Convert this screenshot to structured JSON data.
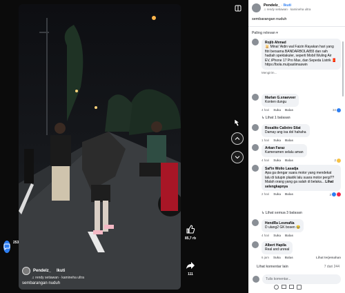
{
  "post": {
    "author": "Pendelz_",
    "follow": "Ikuti",
    "music": "rendy setiawan · kamineha ultra",
    "caption": "sembarangan nuduh"
  },
  "video": {
    "author": "Pendelz_",
    "follow": "Ikuti",
    "music": "rendy setiawan · kamineha ultra",
    "caption": "sembarangan nuduh"
  },
  "rail": {
    "likes": "85,7 rb",
    "comments": "253",
    "shares": "111"
  },
  "panel": {
    "sort_label": "Paling relevan",
    "comments": [
      {
        "name": "Rojib Ahmad",
        "text": "🕌 Minal 'Aidin wal Faizin Rayakan hari yang fitri bersama BANDARBOLA855 dan raih hadiah spektakuler, seperti Mobil Wuling Air EV, iPhone 17 Pro Max, dan Sepeda Listrik 🧧 https://bola.mu/pastimaswin",
        "footer": "Mengirim..."
      },
      {
        "name": "Marlan G.snaeveer",
        "text": "Konten dungu",
        "time": "4 hari",
        "like": "Suka",
        "reply": "Balas",
        "count": "34"
      },
      {
        "more_replies": "Lihat 1 balasan"
      },
      {
        "name": "Rosalito Calixtro Silat",
        "text": "Damay ang isa dol hahaha",
        "time": "1 hari",
        "like": "Suka",
        "reply": "Balas"
      },
      {
        "name": "Arkan Faraz",
        "text": "Kameramen selalu aman",
        "time": "4 hari",
        "like": "Suka",
        "reply": "Balas",
        "count": "2"
      },
      {
        "name": "Saf'in Wolio Lasadja",
        "text": "Apa ga dengar suara motor yang mendekat lalu di tutupin plastik lalu suara motor pergi?? Malah orang yang ga salah di belaka...",
        "see_more": "Lihat selengkapnya",
        "time": "2 hari",
        "like": "Suka",
        "reply": "Balas",
        "count": "3"
      },
      {
        "more_replies": "Lihat semua 3 balasan"
      },
      {
        "name": "HendRa LesmaNa",
        "text": "D ulang2 GK bosen 😂",
        "time": "4 hari",
        "like": "Suka",
        "reply": "Balas"
      },
      {
        "name": "Albert Hapila",
        "text": "Real and unreal",
        "time": "6 jam",
        "like": "Suka",
        "reply": "Balas",
        "translate": "Lihat terjemahan"
      }
    ],
    "more_comments": "Lihat komentar lain",
    "pager": "7 dari 244",
    "input_placeholder": "Tulis komentar..."
  },
  "colors": {
    "accent": "#2d7ef2",
    "panel_bg": "#ffffff",
    "bubble_bg": "#f0f2f5"
  },
  "icons": [
    "collapse-icon",
    "chevron-up-icon",
    "chevron-down-icon",
    "like-icon",
    "comment-icon",
    "share-icon",
    "emoji-icon",
    "camera-icon",
    "gif-icon",
    "sticker-icon"
  ]
}
